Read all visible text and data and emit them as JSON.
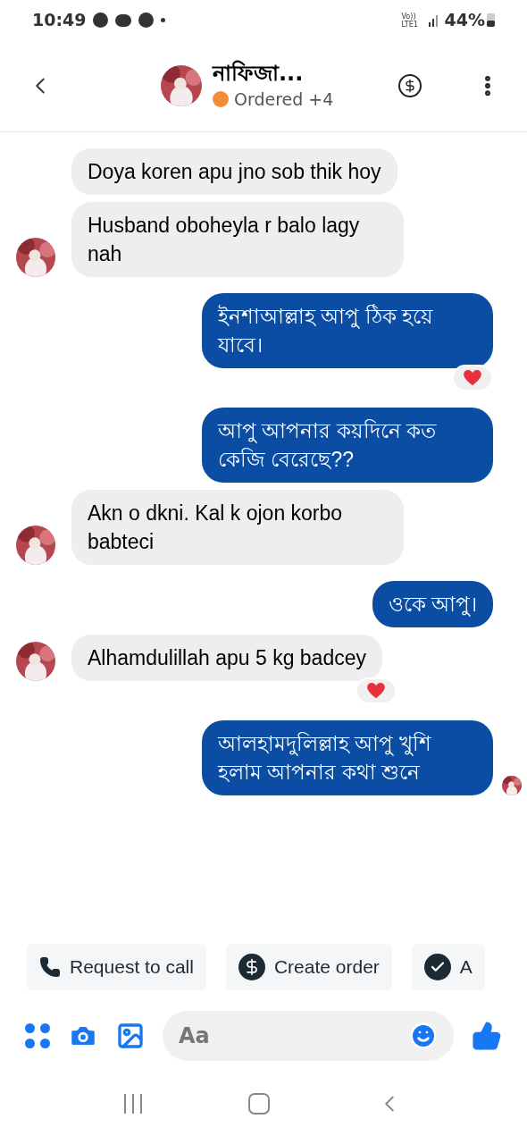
{
  "status_bar": {
    "time": "10:49",
    "network": "Vo)) LTE1",
    "battery": "44%"
  },
  "header": {
    "name": "নাফিজা...",
    "status": "Ordered +4"
  },
  "messages": [
    {
      "kind": "incoming",
      "text": "Doya koren apu jno sob thik hoy",
      "avatar": false,
      "reaction": false
    },
    {
      "kind": "incoming",
      "text": "Husband oboheyla r balo lagy nah",
      "avatar": true,
      "reaction": false
    },
    {
      "kind": "outgoing",
      "text": "ইনশাআল্লাহ আপু ঠিক হয়ে যাবে।",
      "avatar": false,
      "reaction": true
    },
    {
      "kind": "outgoing",
      "text": "আপু আপনার কয়দিনে কত কেজি বেরেছে??",
      "avatar": false,
      "reaction": false
    },
    {
      "kind": "incoming",
      "text": "Akn o dkni. Kal k ojon korbo babteci",
      "avatar": true,
      "reaction": false
    },
    {
      "kind": "outgoing",
      "text": "ওকে আপু।",
      "avatar": false,
      "reaction": false
    },
    {
      "kind": "incoming",
      "text": "Alhamdulillah apu 5 kg badcey",
      "avatar": true,
      "reaction": true
    },
    {
      "kind": "outgoing",
      "text": "আলহামদুলিল্লাহ আপু খুশি হলাম আপনার কথা শুনে",
      "avatar": true,
      "reaction": false
    }
  ],
  "actions": [
    {
      "kind": "call",
      "label": "Request to call"
    },
    {
      "kind": "order",
      "label": "Create order"
    },
    {
      "kind": "check",
      "label": "A"
    }
  ],
  "composer": {
    "placeholder": "Aa"
  }
}
